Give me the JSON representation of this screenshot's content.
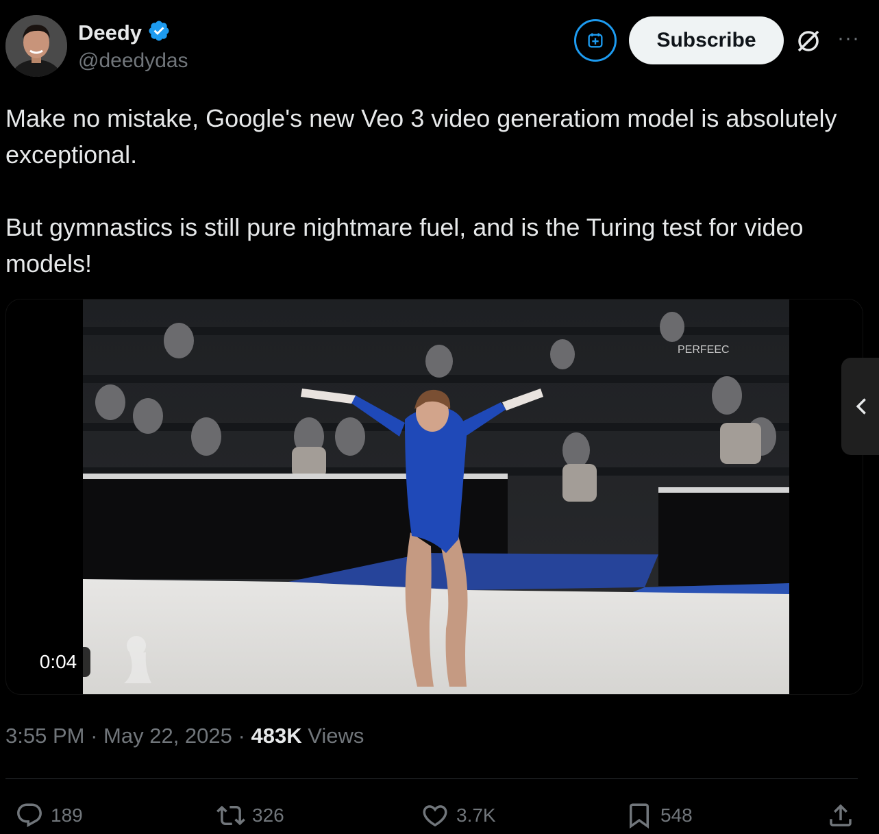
{
  "author": {
    "display_name": "Deedy",
    "handle": "@deedydas",
    "verified": true
  },
  "header": {
    "subscribe_label": "Subscribe",
    "more_label": "···"
  },
  "tweet": {
    "paragraphs": [
      "Make no mistake, Google's new Veo 3 video generatiom model is absolutely exceptional.",
      "But gymnastics is still pure nightmare fuel, and is the Turing test for video models!"
    ]
  },
  "media": {
    "duration": "0:04",
    "watermark_text": "PERFEEC"
  },
  "meta": {
    "time": "3:55 PM",
    "separator": "·",
    "date": "May 22, 2025",
    "views_count": "483K",
    "views_label": "Views"
  },
  "actions": {
    "replies": "189",
    "reposts": "326",
    "likes": "3.7K",
    "bookmarks": "548"
  },
  "colors": {
    "accent": "#1d9bf0",
    "background": "#000000",
    "text_primary": "#e7e9ea",
    "text_secondary": "#71767b",
    "leotard": "#1f49b8"
  }
}
